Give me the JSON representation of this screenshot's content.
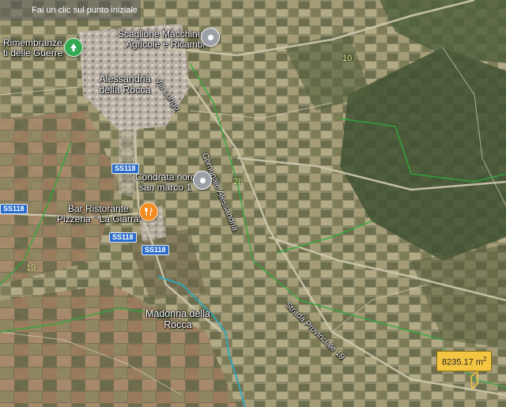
{
  "hint": {
    "text": "Fai un clic sul punto iniziale"
  },
  "places": {
    "alessandria": "Alessandria della Rocca",
    "madonna": "Madonna della Rocca",
    "rimembranze_1": "Rimembranze",
    "rimembranze_2": "ti delle Guerre",
    "scaglione_1": "Scaglione Macchine",
    "scaglione_2": "Agricole e Ricambi",
    "condrata_1": "Condrata noro",
    "condrata_2": "san marco 1",
    "bar_1": "Bar Ristorante",
    "bar_2": "Pizzeria \" La Giarra\""
  },
  "roads": {
    "via_lungo": "Via Lungo",
    "comunale": "Comunale Alessandria",
    "provinciale": "Strada Provinciale 19",
    "ss118_a": "SS118",
    "ss118_b": "SS118",
    "ss118_c": "SS118",
    "ss_left": "SS118",
    "num_28": "28",
    "num_19": "19",
    "num_10": "10"
  },
  "measure": {
    "value": "8235.17 m",
    "unit_sup": "2"
  },
  "icons": {
    "poi_gray": "map-pin-icon",
    "poi_green": "tree-icon",
    "poi_orange": "restaurant-icon"
  },
  "colors": {
    "terrain": "#6f7258",
    "boundary": "#2faa3a",
    "river": "#2fa7b8",
    "road": "#cfc9b0",
    "measure_bg": "#f4c542"
  }
}
